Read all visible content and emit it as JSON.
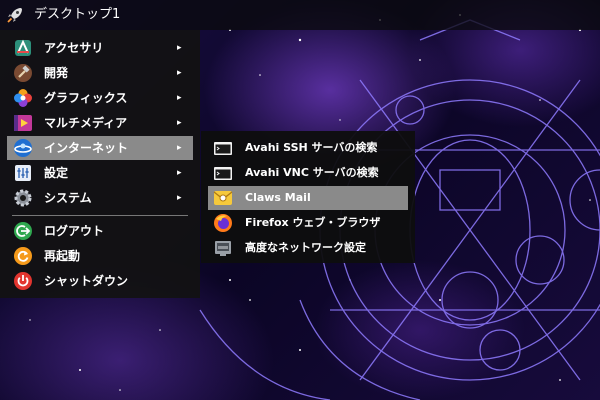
{
  "top_bar": {
    "icon": "rocket-icon",
    "title": "デスクトップ1"
  },
  "main_menu": {
    "items": [
      {
        "label": "アクセサリ",
        "icon": "accessories-icon",
        "has_submenu": true
      },
      {
        "label": "開発",
        "icon": "hammer-icon",
        "has_submenu": true
      },
      {
        "label": "グラフィックス",
        "icon": "graphics-icon",
        "has_submenu": true
      },
      {
        "label": "マルチメディア",
        "icon": "multimedia-icon",
        "has_submenu": true
      },
      {
        "label": "インターネット",
        "icon": "internet-icon",
        "has_submenu": true,
        "selected": true
      },
      {
        "label": "設定",
        "icon": "settings-icon",
        "has_submenu": true
      },
      {
        "label": "システム",
        "icon": "system-gear-icon",
        "has_submenu": true
      }
    ],
    "actions": [
      {
        "label": "ログアウト",
        "icon": "logout-icon"
      },
      {
        "label": "再起動",
        "icon": "reboot-icon"
      },
      {
        "label": "シャットダウン",
        "icon": "power-icon"
      }
    ],
    "arrow": "▸"
  },
  "submenu": {
    "items": [
      {
        "label": "Avahi SSH サーバの検索",
        "icon": "terminal-icon"
      },
      {
        "label": "Avahi VNC サーバの検索",
        "icon": "terminal-icon"
      },
      {
        "label": "Claws Mail",
        "icon": "mail-icon",
        "selected": true
      },
      {
        "label": "Firefox ウェブ・ブラウザ",
        "icon": "firefox-icon"
      },
      {
        "label": "高度なネットワーク設定",
        "icon": "network-icon"
      }
    ]
  },
  "colors": {
    "menu_bg": "#121212",
    "highlight": "#8a8a8a",
    "text": "#ffffff",
    "wallpaper_line": "#8f7bff"
  }
}
